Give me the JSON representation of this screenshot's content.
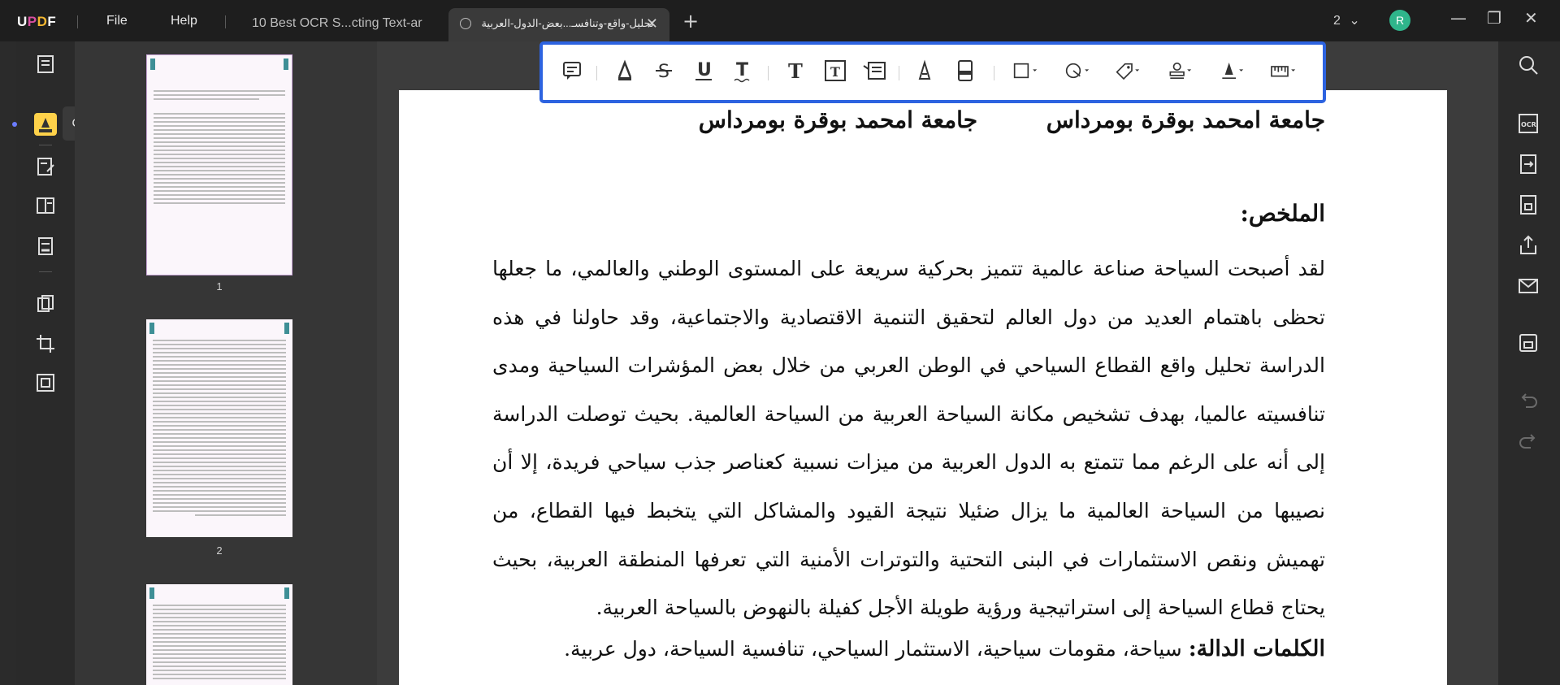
{
  "app": {
    "logo_text": "UPDF",
    "menu": [
      "File",
      "Help"
    ]
  },
  "tabs": [
    {
      "label": "10 Best OCR S...cting Text-ar",
      "active": false
    },
    {
      "label": "تحليل-واقع-وتنافسـ...بعض-الدول-العربية",
      "active": true
    }
  ],
  "window": {
    "page_count": "2",
    "avatar_letter": "R"
  },
  "leftbar": {
    "tooltip": "Comment"
  },
  "thumbnails": {
    "labels": [
      "1",
      "2"
    ]
  },
  "toolbar": {
    "tools": [
      "comment-note",
      "highlight",
      "strikethrough",
      "underline",
      "squiggly",
      "text",
      "text-box",
      "text-callout",
      "pencil",
      "eraser",
      "shape",
      "area-shape",
      "stickers",
      "stamp",
      "signature",
      "measure"
    ]
  },
  "document": {
    "university_right": "جامعة امحمد بوقرة بومرداس",
    "university_left": "جامعة امحمد بوقرة بومرداس",
    "heading": "الملخص:",
    "abstract": "لقد أصبحت السياحة صناعة عالمية تتميز بحركية سريعة على المستوى الوطني والعالمي، ما جعلها تحظى باهتمام العديد من دول العالم لتحقيق التنمية الاقتصادية والاجتماعية، وقد حاولنا في هذه الدراسة تحليل واقع القطاع السياحي في الوطن العربي من خلال بعض المؤشرات السياحية ومدى تنافسيته عالميا، بهدف تشخيص مكانة السياحة العربية من السياحة العالمية. بحيث توصلت الدراسة إلى أنه على الرغم مما تتمتع به الدول العربية من ميزات نسبية كعناصر جذب سياحي فريدة، إلا أن نصيبها من السياحة العالمية ما يزال ضئيلا نتيجة القيود والمشاكل التي يتخبط فيها القطاع، من تهميش ونقص الاستثمارات في البنى التحتية والتوترات الأمنية التي تعرفها المنطقة العربية، بحيث يحتاج قطاع السياحة إلى استراتيجية ورؤية طويلة الأجل كفيلة بالنهوض بالسياحة العربية.",
    "keywords_label": "الكلمات الدالة:",
    "keywords": "سياحة، مقومات سياحية، الاستثمار السياحي، تنافسية السياحة، دول عربية."
  },
  "colors": {
    "accent": "#2d63e0",
    "highlight_tool": "#ffd24a",
    "avatar": "#2fb58b"
  }
}
